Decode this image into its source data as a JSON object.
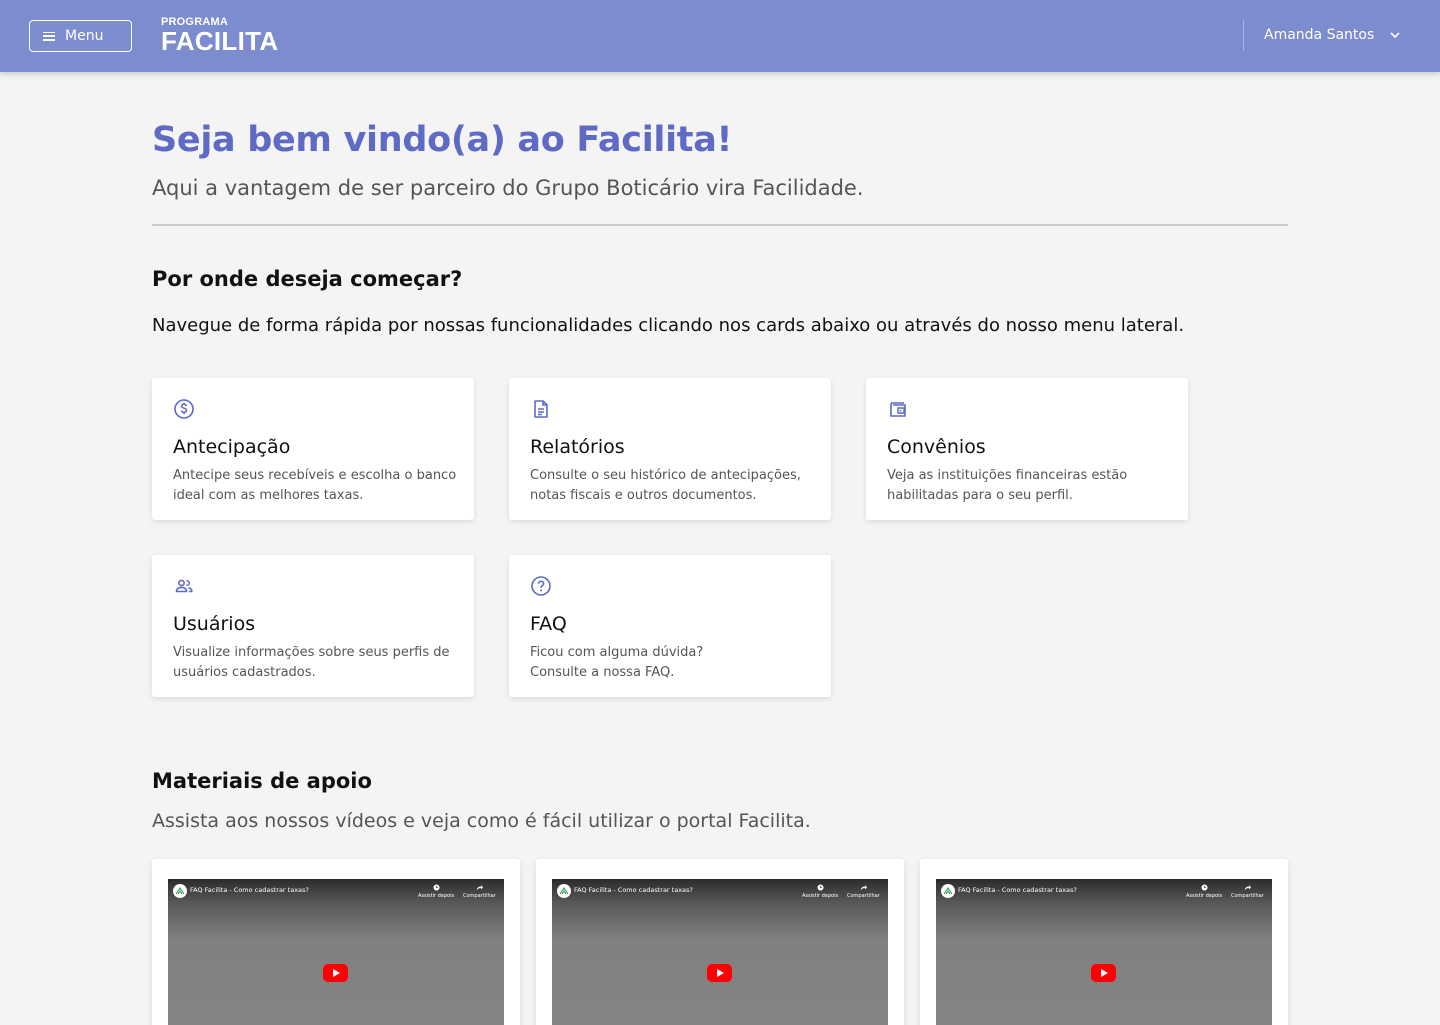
{
  "header": {
    "menu_label": "Menu",
    "logo_small": "PROGRAMA",
    "logo_big": "FACILITA",
    "user_name": "Amanda Santos",
    "bg_color": "#7d8cce"
  },
  "intro": {
    "title": "Seja bem vindo(a) ao Facilita!",
    "subtitle": "Aqui a vantagem de ser parceiro do Grupo Boticário vira Facilidade.",
    "accent_color": "#5f6ac4"
  },
  "start": {
    "heading": "Por onde deseja começar?",
    "description": "Navegue de forma rápida por nossas funcionalidades clicando nos cards abaixo ou através do nosso menu lateral.",
    "cards": [
      {
        "icon": "dollar-circle-icon",
        "title": "Antecipação",
        "text": "Antecipe seus recebíveis e escolha o banco ideal com as melhores taxas."
      },
      {
        "icon": "document-icon",
        "title": "Relatórios",
        "text": "Consulte o seu histórico de antecipações, notas fiscais e outros documentos."
      },
      {
        "icon": "wallet-icon",
        "title": "Convênios",
        "text": "Veja as instituições financeiras estão habilitadas para o seu perfil."
      },
      {
        "icon": "users-icon",
        "title": "Usuários",
        "text": "Visualize informações sobre seus perfis de usuários cadastrados."
      },
      {
        "icon": "question-circle-icon",
        "title": "FAQ",
        "text": "Ficou com alguma dúvida?\nConsulte a nossa FAQ."
      }
    ]
  },
  "materials": {
    "heading": "Materiais de apoio",
    "description": "Assista aos nossos vídeos e veja como é fácil utilizar o portal Facilita.",
    "videos": [
      {
        "title": "FAQ Facilita - Como cadastrar taxas?",
        "watch_later": "Assistir depois",
        "share": "Compartilhar"
      },
      {
        "title": "FAQ Facilita - Como cadastrar taxas?",
        "watch_later": "Assistir depois",
        "share": "Compartilhar"
      },
      {
        "title": "FAQ Facilita - Como cadastrar taxas?",
        "watch_later": "Assistir depois",
        "share": "Compartilhar"
      }
    ]
  }
}
